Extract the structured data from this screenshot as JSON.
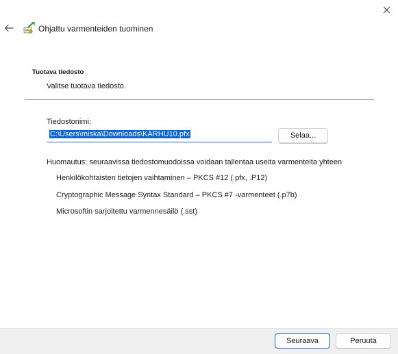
{
  "window": {
    "close_icon": "close-icon",
    "back_icon": "arrow-left-icon",
    "wizard_icon": "certificate-import-icon",
    "title": "Ohjattu varmenteiden tuominen"
  },
  "section": {
    "title": "Tuotava tiedosto",
    "subtitle": "Valitse tuotava tiedosto."
  },
  "file_field": {
    "label": "Tiedostonimi:",
    "value": "C:\\Users\\miska\\Downloads\\KARHU10.pfx",
    "browse_label": "Selaa..."
  },
  "note": "Huomautus: seuraavissa tiedostomuodoissa voidaan tallentaa useita varmenteita yhteen",
  "formats": [
    "Henkilökohtaisten tietojen vaihtaminen – PKCS #12 (.pfx, .P12)",
    "Cryptographic Message Syntax Standard – PKCS #7 -varmenteet (.p7b)",
    "Microsoftin sarjoitettu varmennesäilö (.sst)"
  ],
  "footer": {
    "next_label": "Seuraava",
    "cancel_label": "Peruuta"
  },
  "colors": {
    "accent": "#1f5fbf",
    "selection": "#0a64d2",
    "footer_bg": "#f0f0f0"
  }
}
